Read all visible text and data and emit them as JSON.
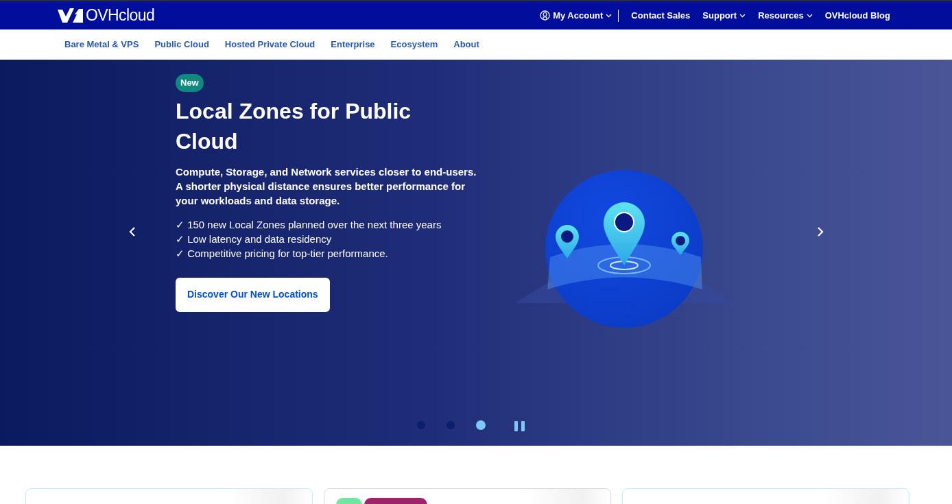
{
  "header": {
    "logo": "OVHcloud",
    "top_links": [
      {
        "label": "My Account",
        "dropdown": true,
        "kind": "account"
      },
      {
        "label": "Contact Sales",
        "dropdown": false,
        "kind": "link"
      },
      {
        "label": "Support",
        "dropdown": true,
        "kind": "link"
      },
      {
        "label": "Resources",
        "dropdown": true,
        "kind": "link"
      },
      {
        "label": "OVHcloud Blog",
        "dropdown": false,
        "kind": "link"
      }
    ]
  },
  "nav": [
    "Bare Metal & VPS",
    "Public Cloud",
    "Hosted Private Cloud",
    "Enterprise",
    "Ecosystem",
    "About"
  ],
  "hero": {
    "badge": "New",
    "title": "Local Zones for Public Cloud",
    "description": "Compute, Storage, and Network services closer to end-users. A shorter physical distance ensures better performance for your workloads and data storage.",
    "bullets": [
      "✓ 150 new Local Zones planned over the next three years",
      "✓ Low latency and data residency",
      "✓ Competitive pricing for top-tier performance."
    ],
    "button": "Discover Our New Locations",
    "slides": [
      {
        "selected": false
      },
      {
        "selected": false
      },
      {
        "selected": true
      }
    ]
  },
  "cards": [
    {
      "kind": "highlighted"
    },
    {
      "kind": "tagged",
      "tags": [
        {
          "color": "#6ee7a0"
        },
        {
          "color": "#a0226a"
        }
      ]
    },
    {
      "kind": "highlighted"
    }
  ]
}
